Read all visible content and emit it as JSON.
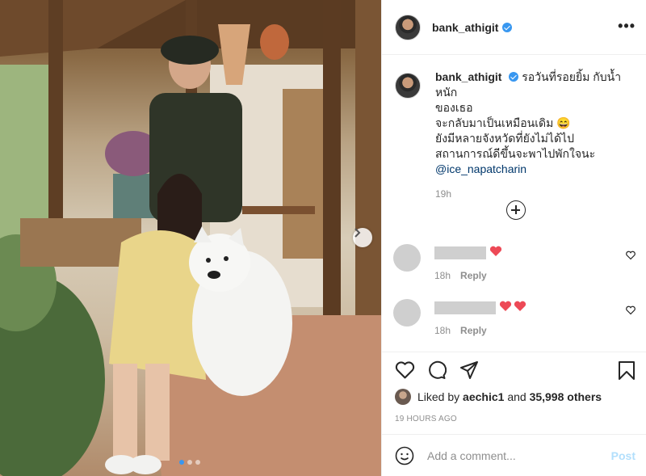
{
  "post": {
    "username": "bank_athigit",
    "verified": true,
    "more_label": "•••"
  },
  "caption": {
    "username": "bank_athigit",
    "line1": "รอวันที่รอยยิ้ม กับน้ำหนัก",
    "line2": "ของเธอ",
    "line3": "จะกลับมาเป็นเหมือนเดิม 😄",
    "line4": "ยังมีหลายจังหวัดที่ยังไม่ได้ไป",
    "line5": "สถานการณ์ดีขึ้นจะพาไปพักใจนะ",
    "mention": "@ice_napatcharin",
    "time": "19h"
  },
  "comments": [
    {
      "hearts": 1,
      "time": "18h",
      "reply_label": "Reply"
    },
    {
      "hearts": 2,
      "time": "18h",
      "reply_label": "Reply"
    }
  ],
  "likes": {
    "prefix": "Liked by ",
    "user": "aechic1",
    "joiner": " and ",
    "others": "35,998 others"
  },
  "posted_time": "19 HOURS AGO",
  "comment_box": {
    "placeholder": "Add a comment...",
    "post_label": "Post"
  },
  "carousel": {
    "total": 3,
    "active_index": 0
  },
  "icons": [
    "more-icon",
    "heart-icon",
    "comment-icon",
    "share-icon",
    "bookmark-icon",
    "emoji-icon",
    "plus-circle-icon",
    "chevron-right-icon"
  ],
  "colors": {
    "accent": "#3897f0",
    "heart_red": "#ed4956",
    "post_disabled": "#b2dffc",
    "muted": "#8e8e8e"
  }
}
